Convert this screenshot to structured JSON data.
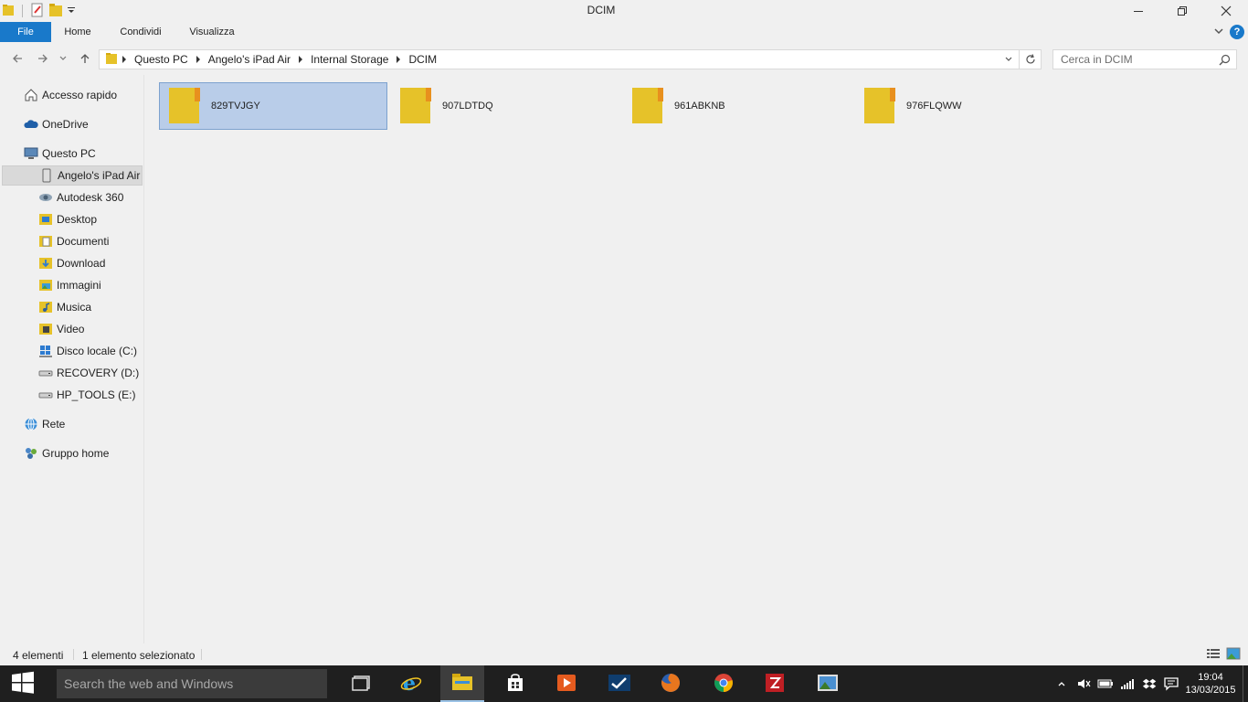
{
  "window": {
    "title": "DCIM"
  },
  "ribbon": {
    "tabs": [
      "File",
      "Home",
      "Condividi",
      "Visualizza"
    ]
  },
  "address": {
    "path": [
      "Questo PC",
      "Angelo's iPad Air",
      "Internal Storage",
      "DCIM"
    ]
  },
  "search": {
    "placeholder": "Cerca in DCIM"
  },
  "navpane": {
    "items": [
      {
        "label": "Accesso rapido",
        "icon": "star-icon"
      },
      {
        "label": "OneDrive",
        "icon": "cloud-icon"
      },
      {
        "label": "Questo PC",
        "icon": "computer-icon"
      },
      {
        "label": "Angelo's iPad Air",
        "icon": "ipad-icon",
        "selected": true
      },
      {
        "label": "Autodesk 360",
        "icon": "autodesk-icon"
      },
      {
        "label": "Desktop",
        "icon": "desktop-folder-icon"
      },
      {
        "label": "Documenti",
        "icon": "documents-folder-icon"
      },
      {
        "label": "Download",
        "icon": "download-folder-icon"
      },
      {
        "label": "Immagini",
        "icon": "pictures-folder-icon"
      },
      {
        "label": "Musica",
        "icon": "music-folder-icon"
      },
      {
        "label": "Video",
        "icon": "video-folder-icon"
      },
      {
        "label": "Disco locale (C:)",
        "icon": "windows-drive-icon"
      },
      {
        "label": "RECOVERY (D:)",
        "icon": "drive-icon"
      },
      {
        "label": "HP_TOOLS (E:)",
        "icon": "drive-icon"
      },
      {
        "label": "Rete",
        "icon": "network-icon"
      },
      {
        "label": "Gruppo home",
        "icon": "homegroup-icon"
      }
    ]
  },
  "content": {
    "folders": [
      {
        "name": "829TVJGY",
        "selected": true
      },
      {
        "name": "907LDTDQ",
        "selected": false
      },
      {
        "name": "961ABKNB",
        "selected": false
      },
      {
        "name": "976FLQWW",
        "selected": false
      }
    ]
  },
  "status": {
    "count": "4 elementi",
    "selection": "1 elemento selezionato"
  },
  "taskbar": {
    "search_placeholder": "Search the web and Windows",
    "apps": [
      "task-view-icon",
      "internet-explorer-icon",
      "file-explorer-icon",
      "store-icon",
      "media-player-icon",
      "app-checkmark-icon",
      "firefox-icon",
      "chrome-icon",
      "filezilla-icon",
      "photo-viewer-icon"
    ],
    "time": "19:04",
    "date": "13/03/2015"
  },
  "colors": {
    "accent": "#1979ca",
    "selection": "#b9cde9",
    "folder": "#e6c229",
    "taskbar": "#1f1f1f"
  }
}
